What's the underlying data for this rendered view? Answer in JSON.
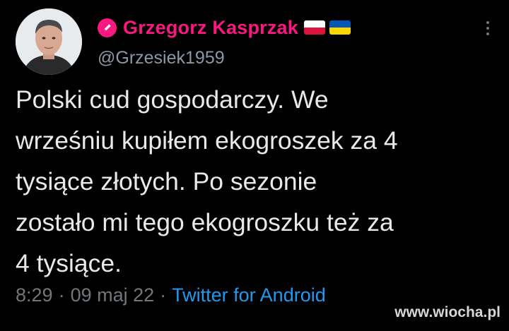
{
  "tweet": {
    "author_name": "Grzegorz Kasprzak",
    "handle": "@Grzesiek1959",
    "text_lines": [
      "Polski cud gospodarczy. We",
      "wrześniu kupiłem ekogroszek za 4",
      "tysiące złotych. Po sezonie",
      "zostało mi tego ekogroszku też za",
      "4 tysiące."
    ],
    "time": "8:29",
    "date": "09 maj 22",
    "separator": "·",
    "source": "Twitter for Android"
  },
  "icons": {
    "name_badge": "pen-icon",
    "flags": [
      "poland-flag-icon",
      "ukraine-flag-icon"
    ],
    "menu": "more-options-icon"
  },
  "colors": {
    "background": "#000000",
    "name": "#f91880",
    "handle": "#8b98a5",
    "text": "#e7e9ea",
    "meta": "#71767b",
    "link": "#1d9bf0"
  },
  "watermark": "www.wiocha.pl"
}
